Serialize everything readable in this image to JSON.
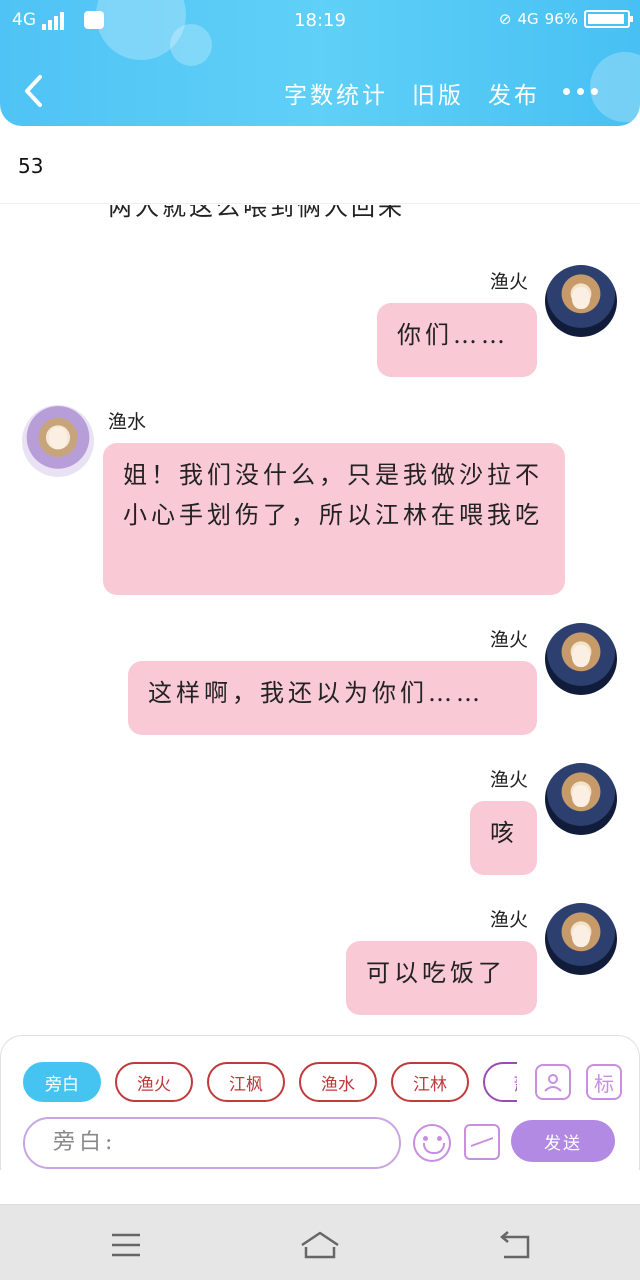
{
  "status_bar": {
    "network_left": "4G",
    "time": "18:19",
    "network_right": "4G",
    "battery": "96%"
  },
  "toolbar": {
    "word_count": "字数统计",
    "old_version": "旧版",
    "publish": "发布"
  },
  "count": "53",
  "chat": {
    "partial_text": "两人就这么喂到俩人回来",
    "messages": [
      {
        "side": "right",
        "name": "渔火",
        "text": "你们……"
      },
      {
        "side": "left",
        "name": "渔水",
        "text": "姐！我们没什么，只是我做沙拉不小心手划伤了，所以江林在喂我吃"
      },
      {
        "side": "right",
        "name": "渔火",
        "text": "这样啊，我还以为你们……"
      },
      {
        "side": "right",
        "name": "渔火",
        "text": "咳"
      },
      {
        "side": "right",
        "name": "渔火",
        "text": "可以吃饭了"
      }
    ]
  },
  "input_panel": {
    "tags": [
      "旁白",
      "渔火",
      "江枫",
      "渔水",
      "江林",
      "萧"
    ],
    "side_btn_role": "role-icon",
    "side_btn_mark": "标",
    "input_placeholder": "旁白:",
    "send_label": "发送"
  },
  "colors": {
    "header": "#4fc3f5",
    "bubble": "#f9c9d5",
    "send": "#b28ae3",
    "tag_active": "#45c4f2",
    "tag_border": "#c0393b"
  }
}
